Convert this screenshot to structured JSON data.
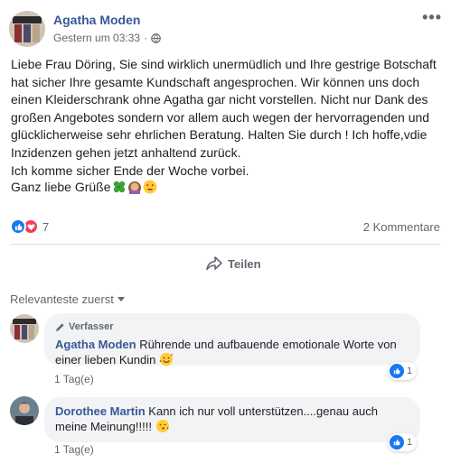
{
  "post": {
    "author": "Agatha Moden",
    "timestamp": "Gestern um 03:33",
    "privacy_icon": "globe-icon",
    "more_icon": "more-horizontal-icon",
    "text": "Liebe Frau Döring, Sie sind wirklich unermüdlich und Ihre gestrige Botschaft hat sicher Ihre gesamte Kundschaft angesprochen. Wir können uns doch einen Kleiderschrank ohne Agatha gar nicht vorstellen. Nicht nur Dank des großen Angebotes sondern vor allem auch wegen der hervorragenden und glücklicherweise sehr ehrlichen Beratung. Halten Sie durch ! Ich hoffe,vdie Inzidenzen gehen jetzt anhaltend zurück.\nIch komme sicher Ende der Woche vorbei.",
    "sign_off": "Ganz liebe Grüße",
    "sign_off_emojis": [
      "clover-emoji",
      "woman-emoji",
      "heart-eyes-emoji"
    ]
  },
  "reactions": {
    "count": "7",
    "types": [
      "like",
      "love"
    ],
    "like_color": "#1877f2",
    "love_color": "#f33e58"
  },
  "comments_count": "2 Kommentare",
  "actions": {
    "share_label": "Teilen"
  },
  "comments_section": {
    "sort_label": "Relevanteste zuerst",
    "items": [
      {
        "author_tag": "Verfasser",
        "author": "Agatha Moden",
        "text": "Rührende und aufbauende emotionale Worte von einer lieben Kundin",
        "emoji": "smiling-face-with-hearts-emoji",
        "time": "1 Tag(e)",
        "likes": "1"
      },
      {
        "author": "Dorothee Martin",
        "text": "Kann ich nur voll unterstützen....genau auch meine Meinung!!!!!",
        "emoji": "face-blowing-kiss-emoji",
        "time": "1 Tag(e)",
        "likes": "1"
      }
    ]
  },
  "colors": {
    "link_blue": "#385898",
    "secondary_text": "#606770",
    "bubble_bg": "#f2f3f5",
    "divider": "#dadde1"
  }
}
